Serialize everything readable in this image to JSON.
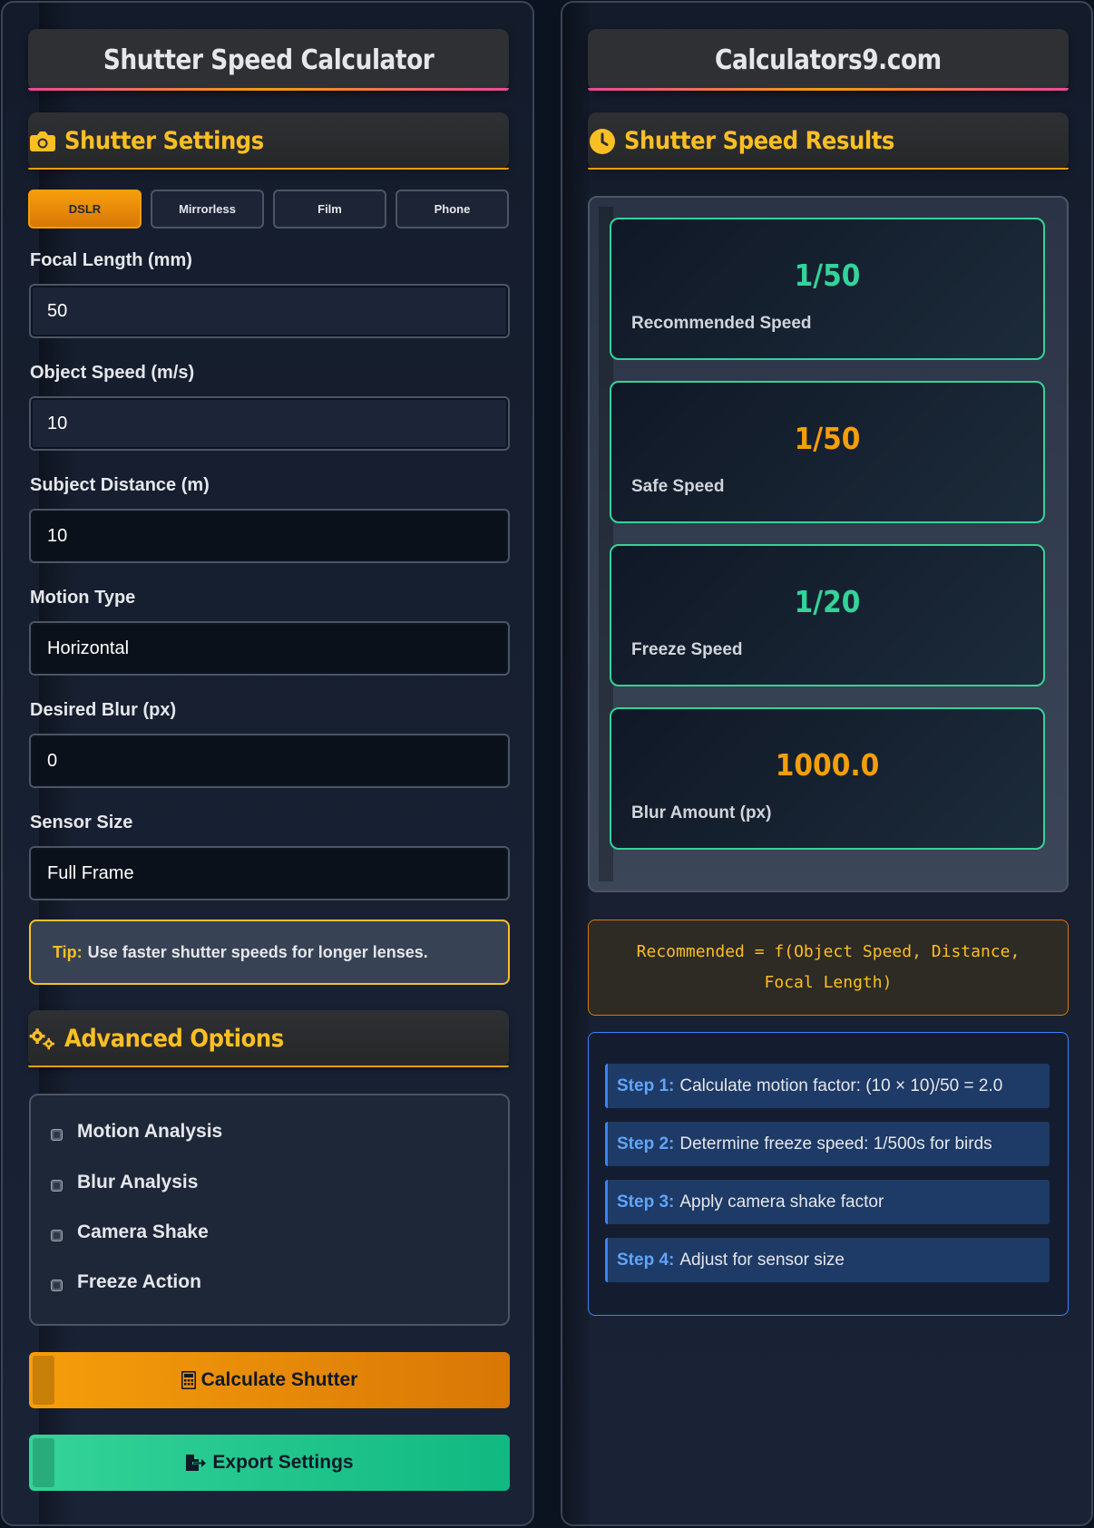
{
  "left": {
    "title": "Shutter Speed Calculator",
    "settings_title": "Shutter Settings",
    "camera_tabs": [
      {
        "label": "DSLR",
        "active": true
      },
      {
        "label": "Mirrorless",
        "active": false
      },
      {
        "label": "Film",
        "active": false
      },
      {
        "label": "Phone",
        "active": false
      }
    ],
    "fields": {
      "focal_length": {
        "label": "Focal Length (mm)",
        "value": "50"
      },
      "object_speed": {
        "label": "Object Speed (m/s)",
        "value": "10"
      },
      "subject_distance": {
        "label": "Subject Distance (m)",
        "value": "10"
      },
      "motion_type": {
        "label": "Motion Type",
        "value": "Horizontal"
      },
      "desired_blur": {
        "label": "Desired Blur (px)",
        "value": "0"
      },
      "sensor_size": {
        "label": "Sensor Size",
        "value": "Full Frame"
      }
    },
    "tip": {
      "prefix": "Tip:",
      "text": "Use faster shutter speeds for longer lenses."
    },
    "advanced_title": "Advanced Options",
    "options": [
      "Motion Analysis",
      "Blur Analysis",
      "Camera Shake",
      "Freeze Action"
    ],
    "calculate_label": "Calculate Shutter",
    "export_label": "Export Settings"
  },
  "right": {
    "title": "Calculators9.com",
    "results_title": "Shutter Speed Results",
    "results": [
      {
        "value": "1/50",
        "label": "Recommended Speed",
        "color": "#34d399"
      },
      {
        "value": "1/50",
        "label": "Safe Speed",
        "color": "#f59e0b"
      },
      {
        "value": "1/20",
        "label": "Freeze Speed",
        "color": "#34d399"
      },
      {
        "value": "1000.0",
        "label": "Blur Amount (px)",
        "color": "#f59e0b"
      }
    ],
    "formula_line1": "Recommended = f(Object Speed, Distance,",
    "formula_line2": "Focal Length)",
    "steps": [
      {
        "label": "Step 1:",
        "text": "Calculate motion factor: (10 × 10)/50 = 2.0"
      },
      {
        "label": "Step 2:",
        "text": "Determine freeze speed: 1/500s for birds"
      },
      {
        "label": "Step 3:",
        "text": "Apply camera shake factor"
      },
      {
        "label": "Step 4:",
        "text": "Adjust for sensor size"
      }
    ]
  },
  "colors": {
    "accent_orange": "#f59e0b",
    "accent_green": "#34d399",
    "accent_blue": "#3b82f6",
    "heading_yellow": "#fbbf24"
  }
}
